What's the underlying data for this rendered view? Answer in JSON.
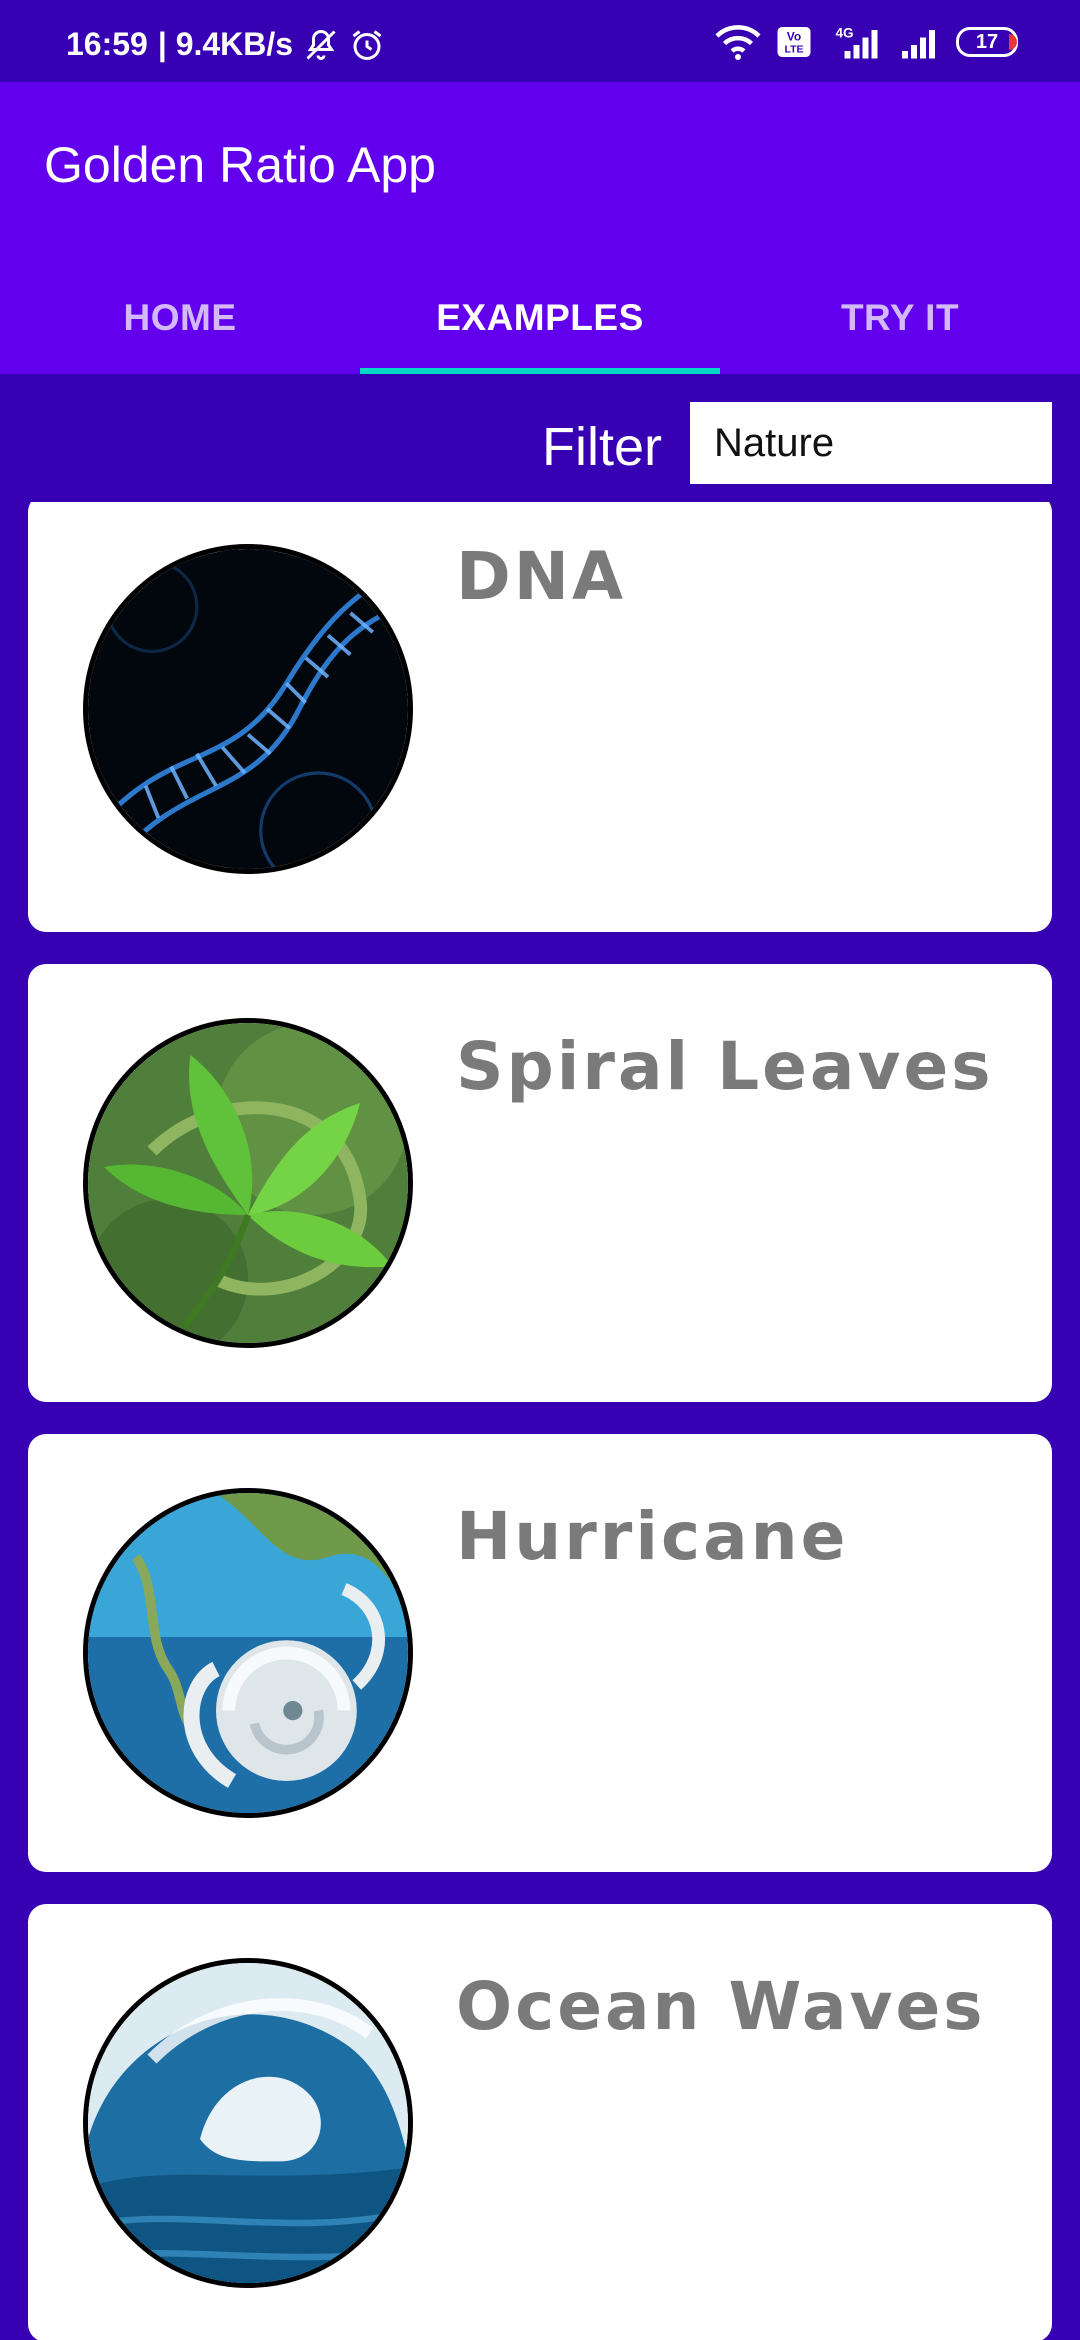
{
  "status_bar": {
    "time": "16:59",
    "net_speed": "| 9.4KB/s",
    "battery": "17",
    "icons": [
      "mute-icon",
      "alarm-icon",
      "wifi-icon",
      "volte-icon",
      "signal-4g-icon",
      "signal-icon",
      "battery-icon"
    ],
    "volte_label": "Vo LTE",
    "network_label": "4G"
  },
  "app_bar": {
    "title": "Golden Ratio App",
    "color": "#6200ee"
  },
  "tabs": [
    {
      "label": "HOME",
      "active": false
    },
    {
      "label": "EXAMPLES",
      "active": true
    },
    {
      "label": "TRY IT",
      "active": false
    }
  ],
  "filter": {
    "label": "Filter",
    "value": "Nature"
  },
  "colors": {
    "background": "#3700b3",
    "primary": "#6200ee",
    "tab_indicator": "#03dac5",
    "card_title": "#7a7a7a"
  },
  "examples": [
    {
      "title": "DNA",
      "image": "dna-image"
    },
    {
      "title": "Spiral Leaves",
      "image": "leaves-image"
    },
    {
      "title": "Hurricane",
      "image": "hurricane-image"
    },
    {
      "title": "Ocean Waves",
      "image": "wave-image"
    }
  ]
}
